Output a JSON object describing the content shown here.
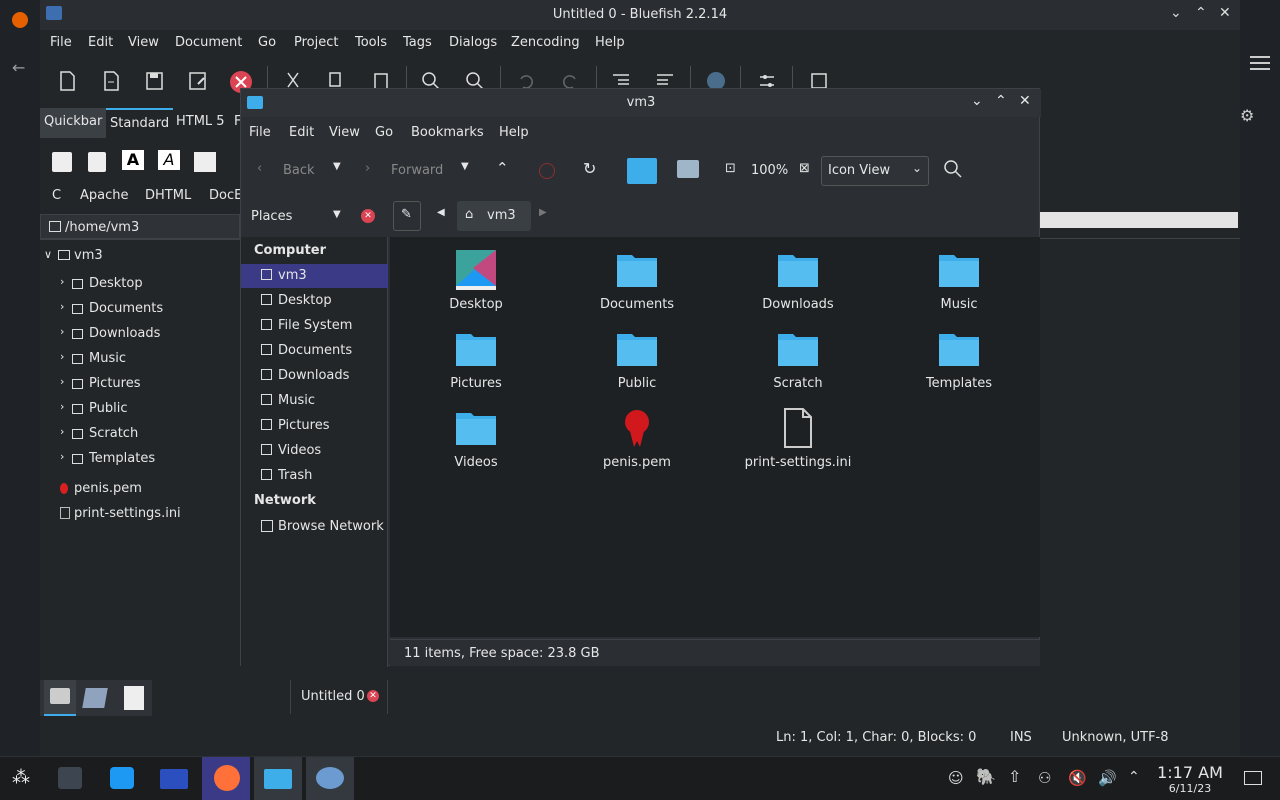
{
  "bluefish": {
    "title": "Untitled 0 - Bluefish 2.2.14",
    "menu": [
      "File",
      "Edit",
      "View",
      "Document",
      "Go",
      "Project",
      "Tools",
      "Tags",
      "Dialogs",
      "Zencoding",
      "Help"
    ],
    "tabs": [
      "Quickbar",
      "Standard",
      "HTML 5",
      "F"
    ],
    "subtabs": [
      "C",
      "Apache",
      "DHTML",
      "DocE"
    ],
    "path": "/home/vm3",
    "tree": {
      "root": "vm3",
      "children": [
        "Desktop",
        "Documents",
        "Downloads",
        "Music",
        "Pictures",
        "Public",
        "Scratch",
        "Templates"
      ],
      "files": [
        "penis.pem",
        "print-settings.ini"
      ]
    },
    "doc_tab": "Untitled 0",
    "status": {
      "position": "Ln: 1, Col: 1, Char: 0, Blocks: 0",
      "mode": "INS",
      "encoding": "Unknown, UTF-8"
    }
  },
  "fm": {
    "title": "vm3",
    "menu": [
      "File",
      "Edit",
      "View",
      "Go",
      "Bookmarks",
      "Help"
    ],
    "toolbar": {
      "back": "Back",
      "forward": "Forward",
      "zoom": "100%",
      "view": "Icon View"
    },
    "places_label": "Places",
    "crumb": "vm3",
    "sections": {
      "computer": "Computer",
      "network": "Network"
    },
    "places": [
      "vm3",
      "Desktop",
      "File System",
      "Documents",
      "Downloads",
      "Music",
      "Pictures",
      "Videos",
      "Trash"
    ],
    "network_places": [
      "Browse Network"
    ],
    "items": [
      "Desktop",
      "Documents",
      "Downloads",
      "Music",
      "Pictures",
      "Public",
      "Scratch",
      "Templates",
      "Videos",
      "penis.pem",
      "print-settings.ini"
    ],
    "status": "11 items, Free space: 23.8 GB"
  },
  "clock": {
    "time": "1:17 AM",
    "date": "6/11/23"
  },
  "colors": {
    "folder": "#3daee9",
    "selection": "#3b3a87",
    "accent": "#3daee9"
  }
}
